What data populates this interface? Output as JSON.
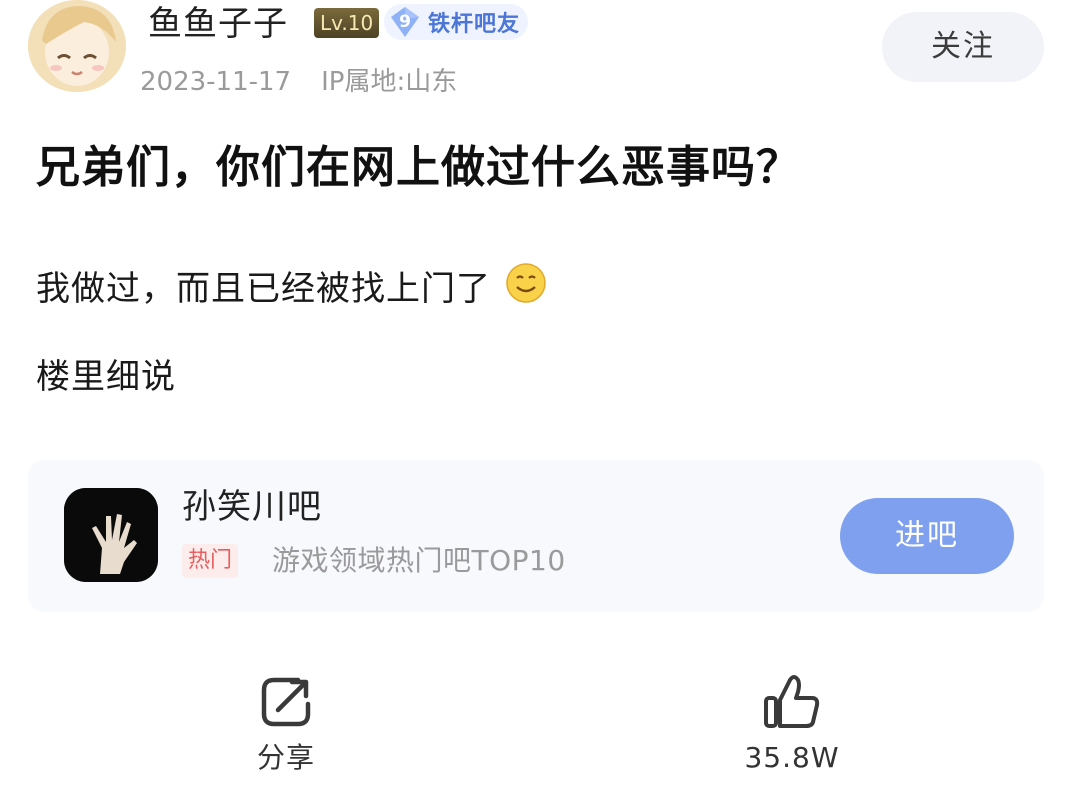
{
  "author": {
    "name": "鱼鱼子子",
    "level_badge": "Lv.10",
    "rank_number": "9",
    "rank_title": "铁杆吧友",
    "date": "2023-11-17",
    "ip_location": "IP属地:山东",
    "follow_label": "关注"
  },
  "post": {
    "title": "兄弟们，你们在网上做过什么恶事吗？",
    "lines": [
      "我做过，而且已经被找上门了",
      "楼里细说"
    ]
  },
  "forum": {
    "name": "孙笑川吧",
    "tag": "热门",
    "rank_text": "游戏领域热门吧TOP10",
    "enter_label": "进吧"
  },
  "actions": {
    "share_label": "分享",
    "like_count": "35.8W"
  },
  "colors": {
    "accent_blue": "#7ea0ee",
    "rank_blue": "#4b76d6",
    "hot_red": "#e46060",
    "meta_gray": "#9a9a9a"
  },
  "icons": {
    "smile": "smile-emoji-icon",
    "share": "share-icon",
    "like": "thumbs-up-icon",
    "rank": "diamond-rank-icon"
  }
}
